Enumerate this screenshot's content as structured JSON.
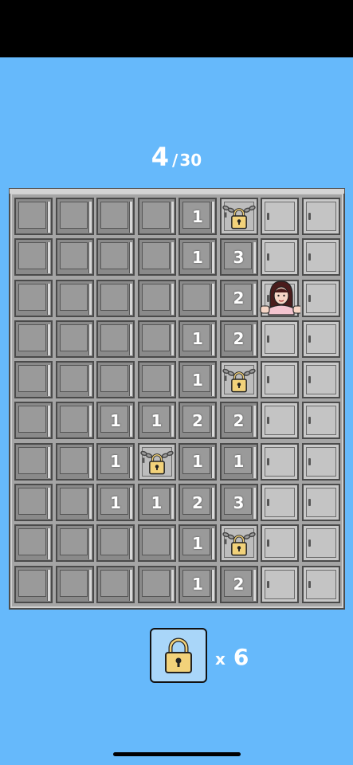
{
  "level": {
    "current": "4",
    "separator": "/",
    "total": "30"
  },
  "board": {
    "rows": [
      [
        "open",
        "open",
        "open",
        "open",
        "1",
        "lock",
        "closed",
        "closed"
      ],
      [
        "open",
        "open",
        "open",
        "open",
        "1",
        "3",
        "closed",
        "closed"
      ],
      [
        "open",
        "open",
        "open",
        "open",
        "open",
        "2",
        "person",
        "closed"
      ],
      [
        "open",
        "open",
        "open",
        "open",
        "1",
        "2",
        "closed",
        "closed"
      ],
      [
        "open",
        "open",
        "open",
        "open",
        "1",
        "lock",
        "closed",
        "closed"
      ],
      [
        "open",
        "open",
        "1",
        "1",
        "2",
        "2",
        "closed",
        "closed"
      ],
      [
        "open",
        "open",
        "1",
        "lock",
        "1",
        "1",
        "closed",
        "closed"
      ],
      [
        "open",
        "open",
        "1",
        "1",
        "2",
        "3",
        "closed",
        "closed"
      ],
      [
        "open",
        "open",
        "open",
        "open",
        "1",
        "lock",
        "closed",
        "closed"
      ],
      [
        "open",
        "open",
        "open",
        "open",
        "1",
        "2",
        "closed",
        "closed"
      ]
    ]
  },
  "inventory": {
    "icon": "padlock-icon",
    "multiplier": "x",
    "count": "6"
  },
  "colors": {
    "background": "#66b9fb",
    "lock_gold": "#f2d27a",
    "chain": "#555555"
  }
}
